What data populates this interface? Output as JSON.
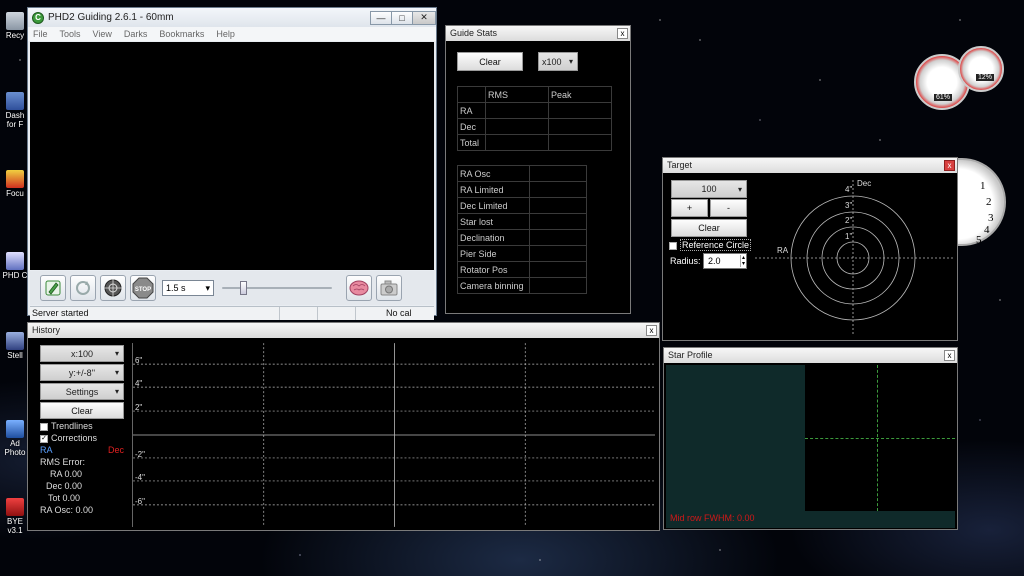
{
  "desktop": {
    "icons": [
      {
        "label": "Recy"
      },
      {
        "label": "Dash for F"
      },
      {
        "label": "Focu"
      },
      {
        "label": "PHD C"
      },
      {
        "label": "Stell"
      },
      {
        "label": "Ad Photo"
      },
      {
        "label": "BYE v3.1"
      }
    ]
  },
  "gadgets": {
    "cpu_percent": "61%",
    "mem_percent": "12%",
    "clock_numbers": [
      "1",
      "2",
      "3",
      "4",
      "5"
    ]
  },
  "main_window": {
    "title": "PHD2 Guiding 2.6.1 - 60mm",
    "app_icon": "C",
    "menu": [
      "File",
      "Tools",
      "View",
      "Darks",
      "Bookmarks",
      "Help"
    ],
    "exposure": "1.5 s",
    "status_left": "Server started",
    "status_right": "No cal",
    "stop_label": "STOP",
    "controls": {
      "minimize": "—",
      "maximize": "□",
      "close": "✕"
    }
  },
  "guide_stats": {
    "title": "Guide Stats",
    "clear": "Clear",
    "scale": "x100",
    "rms_headers": [
      "",
      "RMS",
      "Peak"
    ],
    "rms_rows": [
      "RA",
      "Dec",
      "Total"
    ],
    "info_rows": [
      "RA Osc",
      "RA Limited",
      "Dec Limited",
      "Star lost",
      "Declination",
      "Pier Side",
      "Rotator Pos",
      "Camera binning"
    ]
  },
  "target": {
    "title": "Target",
    "zoom": "100",
    "plus": "+",
    "minus": "-",
    "clear": "Clear",
    "ref_circle": "Reference Circle",
    "radius_label": "Radius:",
    "radius_value": "2.0",
    "axis_dec": "Dec",
    "axis_ra": "RA",
    "ring_labels": [
      "4\"",
      "3\"",
      "2\"",
      "1\""
    ]
  },
  "history": {
    "title": "History",
    "x_scale": "x:100",
    "y_scale": "y:+/-8''",
    "settings": "Settings",
    "clear": "Clear",
    "trendlines": "Trendlines",
    "corrections": "Corrections",
    "ra_label": "RA",
    "dec_label": "Dec",
    "rms_error": "RMS Error:",
    "ra_val": "RA 0.00",
    "dec_val": "Dec 0.00",
    "tot_val": "Tot 0.00",
    "ra_osc": "RA Osc: 0.00",
    "y_labels": [
      "6\"",
      "4\"",
      "2\"",
      "-2\"",
      "-4\"",
      "-6\""
    ],
    "ra_color": "#5aa0ff",
    "dec_color": "#e02020"
  },
  "star_profile": {
    "title": "Star Profile",
    "fwhm": "Mid row FWHM: 0.00",
    "fwhm_color": "#d01818"
  },
  "close_glyph": "x"
}
